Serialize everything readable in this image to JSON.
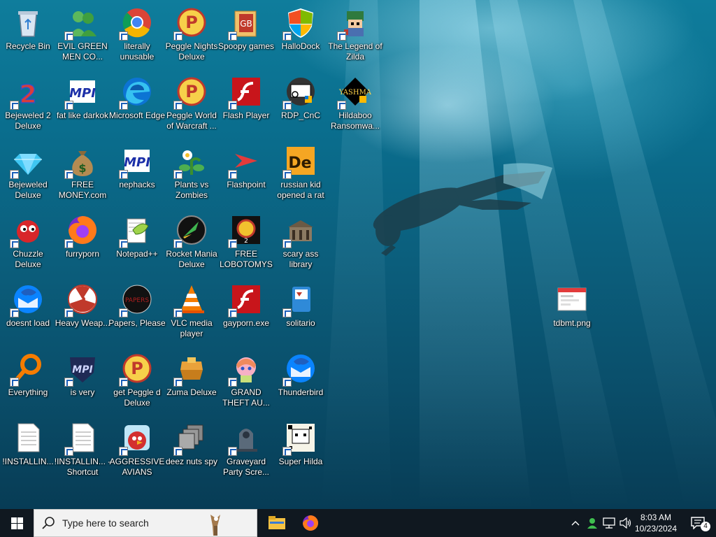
{
  "desktop": {
    "icons": [
      {
        "label": "Recycle Bin",
        "icon": "recycle-bin-icon"
      },
      {
        "label": "EVIL GREEN MEN CO...",
        "icon": "green-men-icon"
      },
      {
        "label": "literally unusable",
        "icon": "chrome-icon"
      },
      {
        "label": "Peggle Nights Deluxe",
        "icon": "peggle-icon"
      },
      {
        "label": "Spoopy games",
        "icon": "folder-icon"
      },
      {
        "label": "HalloDock",
        "icon": "shield-icon"
      },
      {
        "label": "The Legend of Zilda",
        "icon": "pixel-character-icon"
      },
      {
        "label": "Bejeweled 2 Deluxe",
        "icon": "bejeweled2-icon"
      },
      {
        "label": "fat like darkok",
        "icon": "mpi-icon"
      },
      {
        "label": "Microsoft Edge",
        "icon": "edge-icon"
      },
      {
        "label": "Peggle World of Warcraft ...",
        "icon": "peggle-icon"
      },
      {
        "label": "Flash Player",
        "icon": "flash-icon"
      },
      {
        "label": "RDP_CnC",
        "icon": "rdp-icon"
      },
      {
        "label": "Hildaboo Ransomwa...",
        "icon": "yashma-icon"
      },
      {
        "label": "Bejeweled Deluxe",
        "icon": "gem-icon"
      },
      {
        "label": "FREE MONEY.com",
        "icon": "money-bag-icon"
      },
      {
        "label": "nephacks",
        "icon": "mpi-icon"
      },
      {
        "label": "Plants vs Zombies",
        "icon": "flower-icon"
      },
      {
        "label": "Flashpoint",
        "icon": "flashpoint-icon"
      },
      {
        "label": "russian kid opened a rat",
        "icon": "de-icon"
      },
      {
        "label": "Chuzzle Deluxe",
        "icon": "chuzzle-icon"
      },
      {
        "label": "furryporn",
        "icon": "firefox-icon"
      },
      {
        "label": "Notepad++",
        "icon": "notepad-icon"
      },
      {
        "label": "Rocket Mania Deluxe",
        "icon": "rocket-icon"
      },
      {
        "label": "FREE LOBOTOMYS",
        "icon": "lobotomy-icon"
      },
      {
        "label": "scary ass library",
        "icon": "library-icon"
      },
      {
        "label": "doesnt load",
        "icon": "thunderbird-icon"
      },
      {
        "label": "Heavy Weap...",
        "icon": "radiation-icon"
      },
      {
        "label": "Papers, Please",
        "icon": "papers-icon"
      },
      {
        "label": "VLC media player",
        "icon": "vlc-icon"
      },
      {
        "label": "gayporn.exe",
        "icon": "flash-icon"
      },
      {
        "label": "solitario",
        "icon": "solitaire-icon"
      },
      {
        "label": "Everything",
        "icon": "magnifier-icon"
      },
      {
        "label": "is very",
        "icon": "mpi-shield-icon"
      },
      {
        "label": "get Peggle d Deluxe",
        "icon": "peggle-icon"
      },
      {
        "label": "Zuma Deluxe",
        "icon": "zuma-icon"
      },
      {
        "label": "GRAND THEFT AU...",
        "icon": "anime-girl-icon"
      },
      {
        "label": "Thunderbird",
        "icon": "thunderbird-icon"
      },
      {
        "label": "!INSTALLIN...",
        "icon": "text-file-icon"
      },
      {
        "label": "!INSTALLIN... - Shortcut",
        "icon": "text-file-icon"
      },
      {
        "label": "AGGRESSIVE AVIANS",
        "icon": "angry-bird-icon"
      },
      {
        "label": "deez nuts spy",
        "icon": "windows-stack-icon"
      },
      {
        "label": "Graveyard Party Scre...",
        "icon": "gravestone-icon"
      },
      {
        "label": "Super Hilda",
        "icon": "pixel-dog-icon"
      },
      {
        "label": "tdbmt.png",
        "icon": "image-file-icon"
      }
    ]
  },
  "taskbar": {
    "search_placeholder": "Type here to search",
    "apps": [
      "file-explorer-icon",
      "firefox-icon"
    ],
    "tray": [
      "chevron-up-icon",
      "people-icon",
      "network-icon",
      "volume-icon"
    ],
    "time": "8:03 AM",
    "date": "10/23/2024",
    "notification_count": "4"
  }
}
